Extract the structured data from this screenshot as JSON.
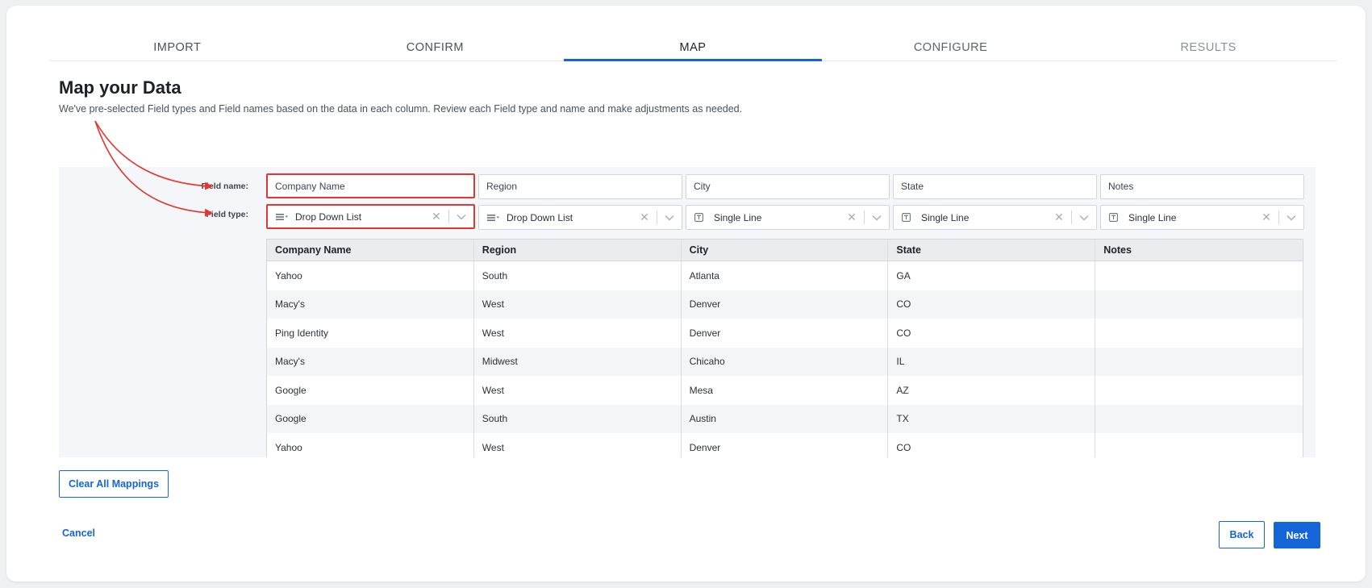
{
  "stepper": {
    "steps": [
      {
        "label": "IMPORT",
        "state": "done"
      },
      {
        "label": "CONFIRM",
        "state": "done"
      },
      {
        "label": "MAP",
        "state": "active"
      },
      {
        "label": "CONFIGURE",
        "state": "todo"
      },
      {
        "label": "RESULTS",
        "state": "future"
      }
    ]
  },
  "page": {
    "title": "Map your Data",
    "description": "We've pre-selected Field types and Field names based on the data in each column. Review each Field type and name and make adjustments as needed."
  },
  "mapping": {
    "field_name_label": "Field name:",
    "field_type_label": "Field type:",
    "field_names": [
      "Company Name",
      "Region",
      "City",
      "State",
      "Notes"
    ],
    "field_types": [
      {
        "label": "Drop Down List",
        "icon": "dropdown-list-icon"
      },
      {
        "label": "Drop Down List",
        "icon": "dropdown-list-icon"
      },
      {
        "label": "Single Line",
        "icon": "text-field-icon"
      },
      {
        "label": "Single Line",
        "icon": "text-field-icon"
      },
      {
        "label": "Single Line",
        "icon": "text-field-icon"
      }
    ]
  },
  "table": {
    "headers": [
      "Company Name",
      "Region",
      "City",
      "State",
      "Notes"
    ],
    "rows": [
      [
        "Yahoo",
        "South",
        "Atlanta",
        "GA",
        ""
      ],
      [
        "Macy's",
        "West",
        "Denver",
        "CO",
        ""
      ],
      [
        "Ping Identity",
        "West",
        "Denver",
        "CO",
        ""
      ],
      [
        "Macy's",
        "Midwest",
        "Chicaho",
        "IL",
        ""
      ],
      [
        "Google",
        "West",
        "Mesa",
        "AZ",
        ""
      ],
      [
        "Google",
        "South",
        "Austin",
        "TX",
        ""
      ],
      [
        "Yahoo",
        "West",
        "Denver",
        "CO",
        ""
      ]
    ]
  },
  "actions": {
    "clear_all": "Clear All Mappings",
    "cancel": "Cancel",
    "back": "Back",
    "next": "Next"
  },
  "colors": {
    "accent": "#1565d8",
    "annotation": "#e0382f"
  }
}
